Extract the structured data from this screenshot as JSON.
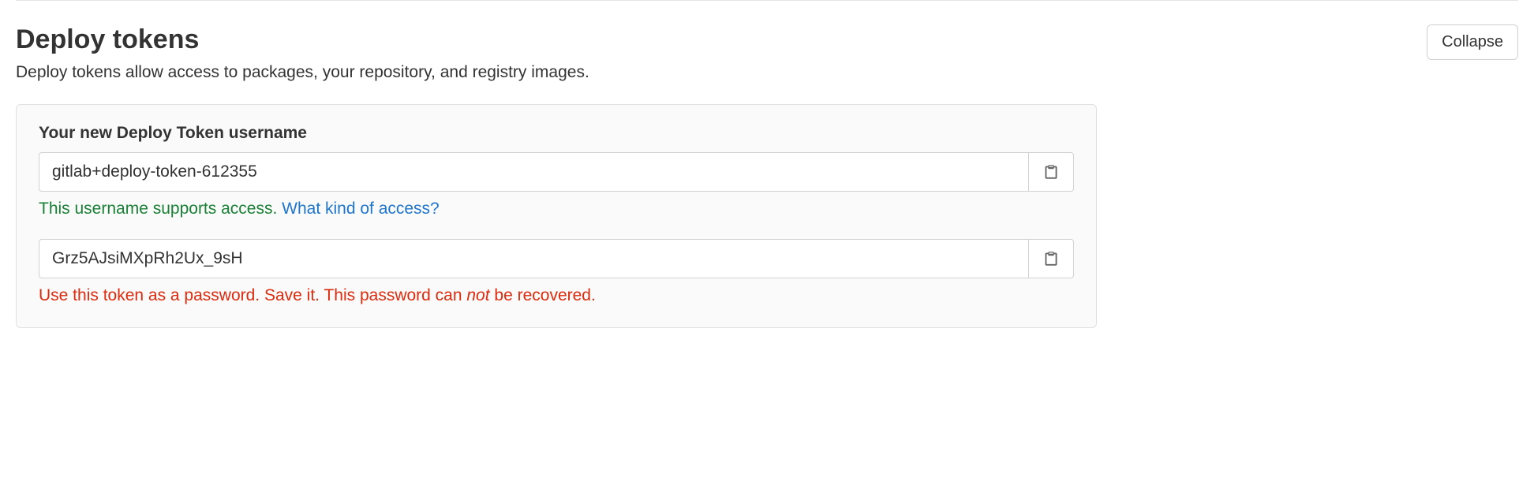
{
  "header": {
    "title": "Deploy tokens",
    "description": "Deploy tokens allow access to packages, your repository, and registry images.",
    "collapse_label": "Collapse"
  },
  "panel": {
    "username_label": "Your new Deploy Token username",
    "username_value": "gitlab+deploy-token-612355",
    "username_help_text": "This username supports access. ",
    "username_help_link": "What kind of access?",
    "token_value": "Grz5AJsiMXpRh2Ux_9sH",
    "token_help_prefix": "Use this token as a password. Save it. This password can ",
    "token_help_emphasis": "not",
    "token_help_suffix": " be recovered."
  }
}
